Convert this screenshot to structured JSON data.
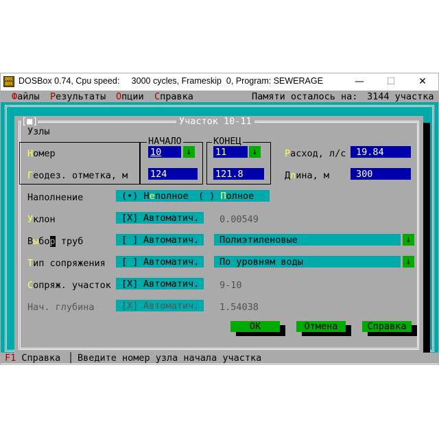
{
  "window": {
    "title": "DOSBox 0.74, Cpu speed:     3000 cycles, Frameskip  0, Program: SEWERAGE",
    "icon": "dosbox-icon",
    "icon_text": "DOS\nBOX",
    "minimize": "—",
    "maximize": "☐",
    "close": "✕"
  },
  "menu": {
    "items": [
      {
        "hot": "Ф",
        "rest": "айлы"
      },
      {
        "hot": "Р",
        "rest": "езультаты"
      },
      {
        "hot": "О",
        "rest": "пции"
      },
      {
        "hot": "С",
        "rest": "правка"
      }
    ],
    "memory_label": "Памяти осталось на:",
    "memory_value": "3144 участка"
  },
  "dialog": {
    "close_box": "[■]",
    "title": "Участок 10-11",
    "nodes_label": "Узлы",
    "start_header": "НАЧАЛО",
    "end_header": "КОНЕЦ",
    "number_label": {
      "hot": "Н",
      "rest": "омер"
    },
    "geodetic_label": {
      "hot": "Г",
      "rest": "еодез. отметка, м"
    },
    "start_number": "10",
    "end_number": "11",
    "start_elevation": "124",
    "end_elevation": "121.8",
    "flow_label": {
      "hot": "Р",
      "rest": "асход, л/с"
    },
    "flow_value": "19.84",
    "length_label": {
      "pre": "Д",
      "hot": "л",
      "rest": "ина, м"
    },
    "length_value": "300",
    "fill_label": "Наполнение",
    "fill_options": {
      "partial_radio": "(•)",
      "partial_hot": "Н",
      "partial_pre": "",
      "partial_label": "е",
      "partial_rest": "полное",
      "full_radio": "( )",
      "full_hot": "П",
      "full_rest": "олное"
    },
    "slope_label": {
      "hot": "У",
      "rest": "клон"
    },
    "slope_checkbox": "[X]",
    "slope_auto": "Автоматич.",
    "slope_value": "0.00549",
    "pipes_label": {
      "pre": "В",
      "hot": "ы",
      "mid": "бо",
      "cursor": "р",
      "rest": " труб"
    },
    "pipes_checkbox": "[ ]",
    "pipes_auto": "Автоматич.",
    "pipes_value": "Полиэтиленовые",
    "joint_type_label": {
      "hot": "Т",
      "rest": "ип сопряжения"
    },
    "joint_type_checkbox": "[ ]",
    "joint_type_auto": "Автоматич.",
    "joint_type_value": "По уровням воды",
    "joined_section_label": {
      "hot": "С",
      "rest": "опряж. участок"
    },
    "joined_section_checkbox": "[X]",
    "joined_section_auto": "Автоматич.",
    "joined_section_value": "9-10",
    "start_depth_label": "Нач. глубина",
    "start_depth_checkbox": "[X]",
    "start_depth_auto": "Автоматич.",
    "start_depth_value": "1.54038",
    "combo_arrow": "↓",
    "ok": "OK",
    "cancel": "Отмена",
    "help": "Справка"
  },
  "status": {
    "key": "F1",
    "key_label": "Справка",
    "separator": "│",
    "hint": "Введите номер узла начала участка"
  },
  "colors": {
    "dos_gray": "#aaaaaa",
    "dos_cyan": "#00aaaa",
    "dos_blue": "#0000aa",
    "dos_green": "#00aa00",
    "dos_yellow": "#ffff55",
    "dos_red": "#aa0000"
  }
}
